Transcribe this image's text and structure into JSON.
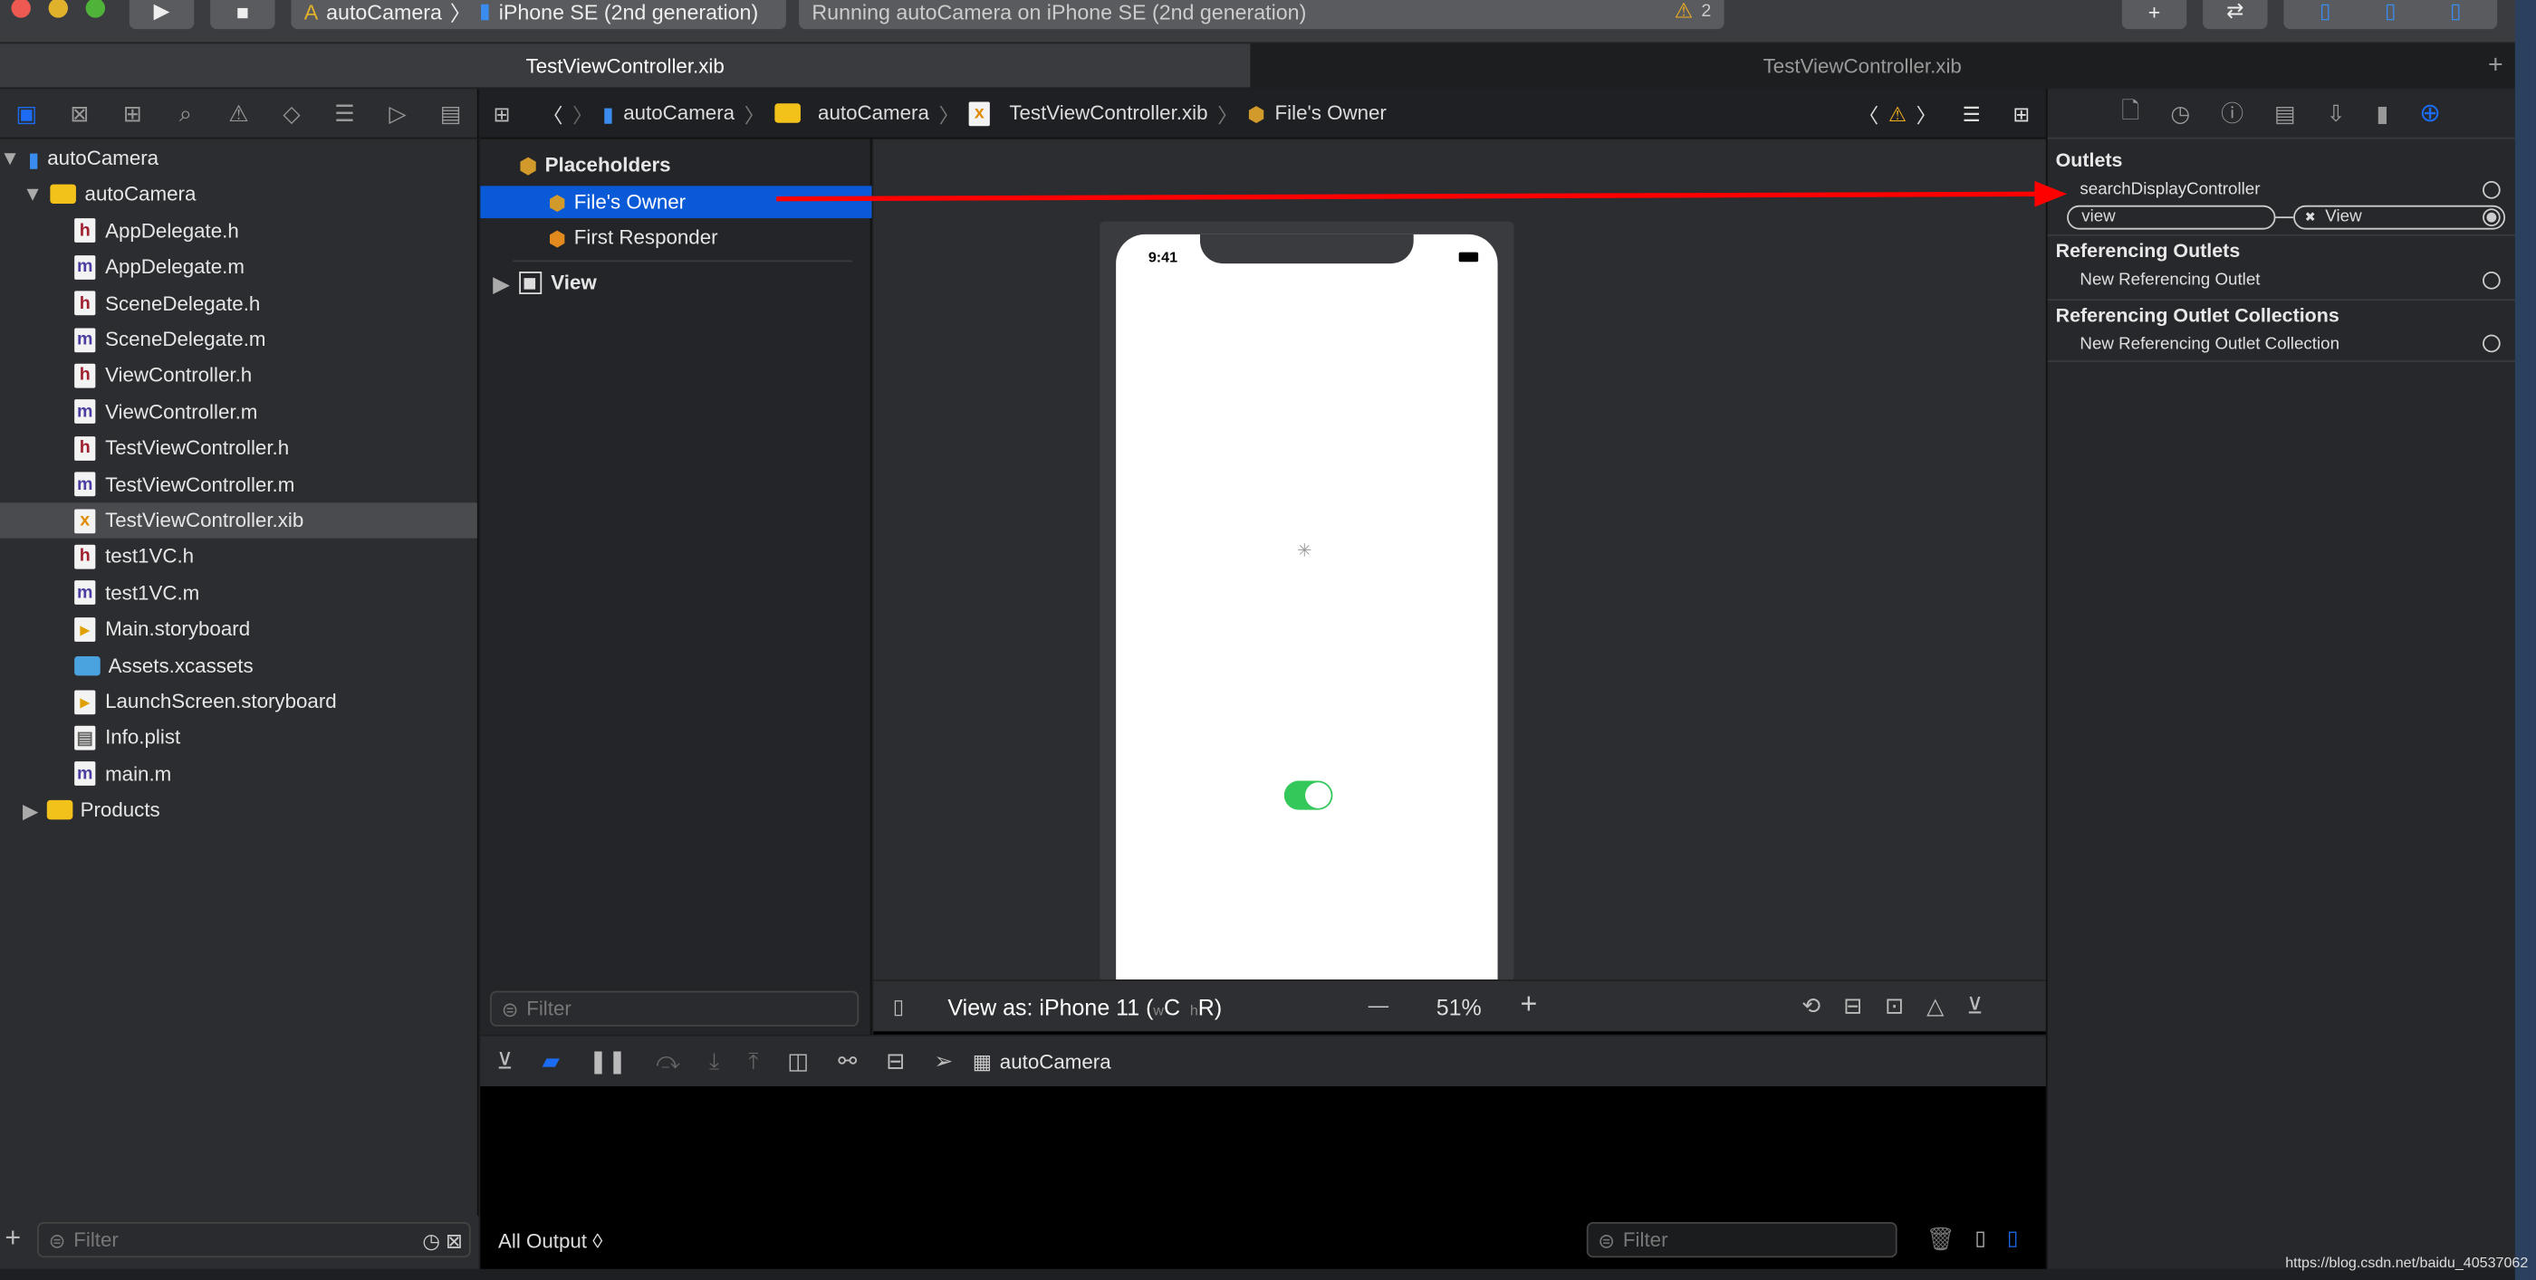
{
  "toolbar": {
    "scheme": "autoCamera",
    "device": "iPhone SE (2nd generation)",
    "status": "Running autoCamera on iPhone SE (2nd generation)",
    "warning_count": "2"
  },
  "tabs": [
    {
      "label": "TestViewController.xib",
      "active": true
    },
    {
      "label": "TestViewController.xib",
      "active": false
    }
  ],
  "navigator": {
    "project": "autoCamera",
    "group": "autoCamera",
    "files": [
      {
        "name": "AppDelegate.h",
        "type": "h"
      },
      {
        "name": "AppDelegate.m",
        "type": "m"
      },
      {
        "name": "SceneDelegate.h",
        "type": "h"
      },
      {
        "name": "SceneDelegate.m",
        "type": "m"
      },
      {
        "name": "ViewController.h",
        "type": "h"
      },
      {
        "name": "ViewController.m",
        "type": "m"
      },
      {
        "name": "TestViewController.h",
        "type": "h"
      },
      {
        "name": "TestViewController.m",
        "type": "m"
      },
      {
        "name": "TestViewController.xib",
        "type": "xib",
        "selected": true
      },
      {
        "name": "test1VC.h",
        "type": "h"
      },
      {
        "name": "test1VC.m",
        "type": "m"
      },
      {
        "name": "Main.storyboard",
        "type": "sb"
      },
      {
        "name": "Assets.xcassets",
        "type": "assets"
      },
      {
        "name": "LaunchScreen.storyboard",
        "type": "sb"
      },
      {
        "name": "Info.plist",
        "type": "plist"
      },
      {
        "name": "main.m",
        "type": "m"
      }
    ],
    "products": "Products",
    "filter_placeholder": "Filter"
  },
  "jumpbar": [
    "autoCamera",
    "autoCamera",
    "TestViewController.xib",
    "File's Owner"
  ],
  "outline": {
    "placeholders": "Placeholders",
    "files_owner": "File's Owner",
    "first_responder": "First Responder",
    "view": "View",
    "filter_placeholder": "Filter"
  },
  "device": {
    "time": "9:41",
    "switch_on": true,
    "accent": "#34c759"
  },
  "canvas_bar": {
    "view_as": "View as: iPhone 11 (",
    "w": "w",
    "c": "C",
    "h": "h",
    "r": "R)",
    "zoom": "51%",
    "minus": "—",
    "plus": "+"
  },
  "debug": {
    "target": "autoCamera"
  },
  "console": {
    "output_selector": "All Output ◊",
    "filter_placeholder": "Filter"
  },
  "inspector": {
    "outlets_title": "Outlets",
    "outlets": [
      {
        "name": "searchDisplayController",
        "connected": false
      },
      {
        "name": "view",
        "connected": true,
        "target": "View"
      }
    ],
    "ref_title": "Referencing Outlets",
    "ref_item": "New Referencing Outlet",
    "coll_title": "Referencing Outlet Collections",
    "coll_item": "New Referencing Outlet Collection"
  },
  "watermark": "https://blog.csdn.net/baidu_40537062",
  "colors": {
    "selection": "#0a59d6",
    "arrow": "#ff0000",
    "accent": "#1b6cf2"
  }
}
